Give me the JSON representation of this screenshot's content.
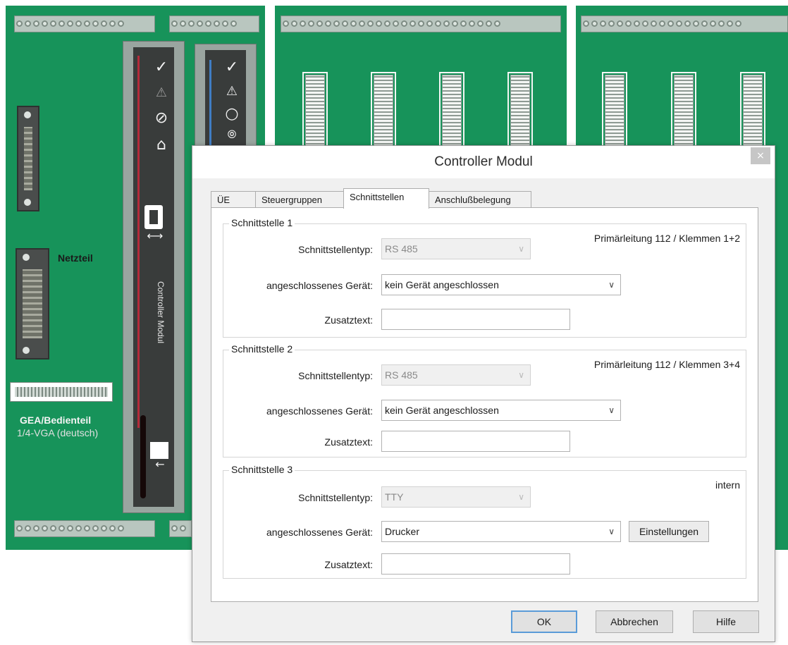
{
  "board": {
    "netzteil_label": "Netzteil",
    "gea_label": "GEA/Bedienteil",
    "vga_label": "1/4-VGA (deutsch)",
    "module_label": "Controller Modul"
  },
  "dialog": {
    "title": "Controller Modul",
    "close": "×",
    "tabs": [
      {
        "label": "ÜE"
      },
      {
        "label": "Steuergruppen"
      },
      {
        "label": "Schnittstellen"
      },
      {
        "label": "Anschlußbelegung"
      }
    ],
    "interfaces": [
      {
        "title": "Schnittstelle 1",
        "info": "Primärleitung 112 / Klemmen 1+2",
        "type_label": "Schnittstellentyp:",
        "type_value": "RS 485",
        "device_label": "angeschlossenes Gerät:",
        "device_value": "kein Gerät angeschlossen",
        "extra_label": "Zusatztext:",
        "extra_value": ""
      },
      {
        "title": "Schnittstelle 2",
        "info": "Primärleitung 112 / Klemmen 3+4",
        "type_label": "Schnittstellentyp:",
        "type_value": "RS 485",
        "device_label": "angeschlossenes Gerät:",
        "device_value": "kein Gerät angeschlossen",
        "extra_label": "Zusatztext:",
        "extra_value": ""
      },
      {
        "title": "Schnittstelle 3",
        "info": "intern",
        "type_label": "Schnittstellentyp:",
        "type_value": "TTY",
        "device_label": "angeschlossenes Gerät:",
        "device_value": "Drucker",
        "extra_label": "Zusatztext:",
        "extra_value": "",
        "settings_button": "Einstellungen"
      }
    ],
    "buttons": {
      "ok": "OK",
      "cancel": "Abbrechen",
      "help": "Hilfe"
    }
  },
  "colors": {
    "board_green": "#17935a",
    "accent_blue": "#5a9bd8"
  }
}
